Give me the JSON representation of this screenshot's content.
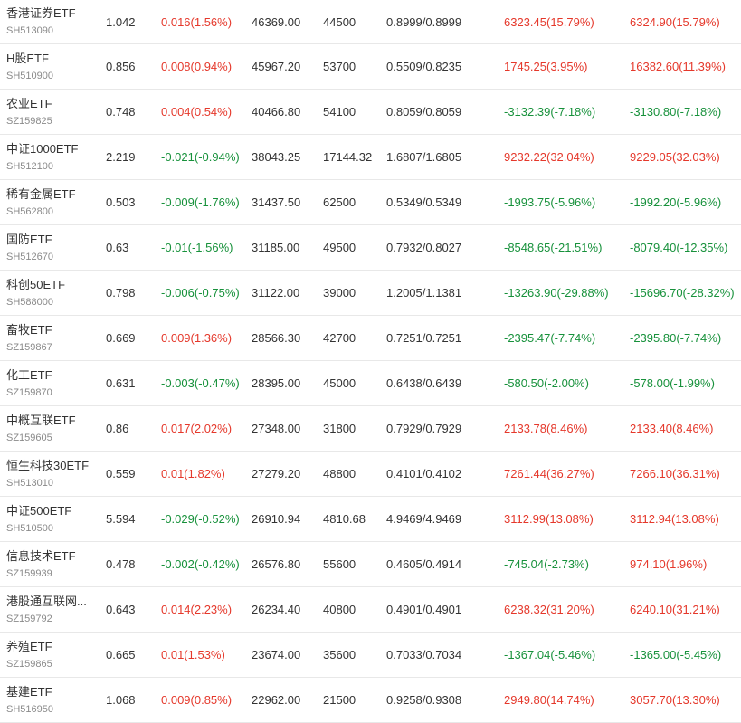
{
  "colors": {
    "up": "#e5382b",
    "down": "#17913b"
  },
  "rows": [
    {
      "name": "香港证券ETF",
      "code": "SH513090",
      "price": "1.042",
      "change": "0.016(1.56%)",
      "change_dir": "up",
      "volume": "46369.00",
      "shares": "44500",
      "nav": "0.8999/0.8999",
      "pl1": "6323.45(15.79%)",
      "pl1_dir": "up",
      "pl2": "6324.90(15.79%)",
      "pl2_dir": "up"
    },
    {
      "name": "H股ETF",
      "code": "SH510900",
      "price": "0.856",
      "change": "0.008(0.94%)",
      "change_dir": "up",
      "volume": "45967.20",
      "shares": "53700",
      "nav": "0.5509/0.8235",
      "pl1": "1745.25(3.95%)",
      "pl1_dir": "up",
      "pl2": "16382.60(11.39%)",
      "pl2_dir": "up"
    },
    {
      "name": "农业ETF",
      "code": "SZ159825",
      "price": "0.748",
      "change": "0.004(0.54%)",
      "change_dir": "up",
      "volume": "40466.80",
      "shares": "54100",
      "nav": "0.8059/0.8059",
      "pl1": "-3132.39(-7.18%)",
      "pl1_dir": "down",
      "pl2": "-3130.80(-7.18%)",
      "pl2_dir": "down"
    },
    {
      "name": "中证1000ETF",
      "code": "SH512100",
      "price": "2.219",
      "change": "-0.021(-0.94%)",
      "change_dir": "down",
      "volume": "38043.25",
      "shares": "17144.32",
      "nav": "1.6807/1.6805",
      "pl1": "9232.22(32.04%)",
      "pl1_dir": "up",
      "pl2": "9229.05(32.03%)",
      "pl2_dir": "up"
    },
    {
      "name": "稀有金属ETF",
      "code": "SH562800",
      "price": "0.503",
      "change": "-0.009(-1.76%)",
      "change_dir": "down",
      "volume": "31437.50",
      "shares": "62500",
      "nav": "0.5349/0.5349",
      "pl1": "-1993.75(-5.96%)",
      "pl1_dir": "down",
      "pl2": "-1992.20(-5.96%)",
      "pl2_dir": "down"
    },
    {
      "name": "国防ETF",
      "code": "SH512670",
      "price": "0.63",
      "change": "-0.01(-1.56%)",
      "change_dir": "down",
      "volume": "31185.00",
      "shares": "49500",
      "nav": "0.7932/0.8027",
      "pl1": "-8548.65(-21.51%)",
      "pl1_dir": "down",
      "pl2": "-8079.40(-12.35%)",
      "pl2_dir": "down"
    },
    {
      "name": "科创50ETF",
      "code": "SH588000",
      "price": "0.798",
      "change": "-0.006(-0.75%)",
      "change_dir": "down",
      "volume": "31122.00",
      "shares": "39000",
      "nav": "1.2005/1.1381",
      "pl1": "-13263.90(-29.88%)",
      "pl1_dir": "down",
      "pl2": "-15696.70(-28.32%)",
      "pl2_dir": "down"
    },
    {
      "name": "畜牧ETF",
      "code": "SZ159867",
      "price": "0.669",
      "change": "0.009(1.36%)",
      "change_dir": "up",
      "volume": "28566.30",
      "shares": "42700",
      "nav": "0.7251/0.7251",
      "pl1": "-2395.47(-7.74%)",
      "pl1_dir": "down",
      "pl2": "-2395.80(-7.74%)",
      "pl2_dir": "down"
    },
    {
      "name": "化工ETF",
      "code": "SZ159870",
      "price": "0.631",
      "change": "-0.003(-0.47%)",
      "change_dir": "down",
      "volume": "28395.00",
      "shares": "45000",
      "nav": "0.6438/0.6439",
      "pl1": "-580.50(-2.00%)",
      "pl1_dir": "down",
      "pl2": "-578.00(-1.99%)",
      "pl2_dir": "down"
    },
    {
      "name": "中概互联ETF",
      "code": "SZ159605",
      "price": "0.86",
      "change": "0.017(2.02%)",
      "change_dir": "up",
      "volume": "27348.00",
      "shares": "31800",
      "nav": "0.7929/0.7929",
      "pl1": "2133.78(8.46%)",
      "pl1_dir": "up",
      "pl2": "2133.40(8.46%)",
      "pl2_dir": "up"
    },
    {
      "name": "恒生科技30ETF",
      "code": "SH513010",
      "price": "0.559",
      "change": "0.01(1.82%)",
      "change_dir": "up",
      "volume": "27279.20",
      "shares": "48800",
      "nav": "0.4101/0.4102",
      "pl1": "7261.44(36.27%)",
      "pl1_dir": "up",
      "pl2": "7266.10(36.31%)",
      "pl2_dir": "up"
    },
    {
      "name": "中证500ETF",
      "code": "SH510500",
      "price": "5.594",
      "change": "-0.029(-0.52%)",
      "change_dir": "down",
      "volume": "26910.94",
      "shares": "4810.68",
      "nav": "4.9469/4.9469",
      "pl1": "3112.99(13.08%)",
      "pl1_dir": "up",
      "pl2": "3112.94(13.08%)",
      "pl2_dir": "up"
    },
    {
      "name": "信息技术ETF",
      "code": "SZ159939",
      "price": "0.478",
      "change": "-0.002(-0.42%)",
      "change_dir": "down",
      "volume": "26576.80",
      "shares": "55600",
      "nav": "0.4605/0.4914",
      "pl1": "-745.04(-2.73%)",
      "pl1_dir": "down",
      "pl2": "974.10(1.96%)",
      "pl2_dir": "up"
    },
    {
      "name": "港股通互联网...",
      "code": "SZ159792",
      "price": "0.643",
      "change": "0.014(2.23%)",
      "change_dir": "up",
      "volume": "26234.40",
      "shares": "40800",
      "nav": "0.4901/0.4901",
      "pl1": "6238.32(31.20%)",
      "pl1_dir": "up",
      "pl2": "6240.10(31.21%)",
      "pl2_dir": "up"
    },
    {
      "name": "养殖ETF",
      "code": "SZ159865",
      "price": "0.665",
      "change": "0.01(1.53%)",
      "change_dir": "up",
      "volume": "23674.00",
      "shares": "35600",
      "nav": "0.7033/0.7034",
      "pl1": "-1367.04(-5.46%)",
      "pl1_dir": "down",
      "pl2": "-1365.00(-5.45%)",
      "pl2_dir": "down"
    },
    {
      "name": "基建ETF",
      "code": "SH516950",
      "price": "1.068",
      "change": "0.009(0.85%)",
      "change_dir": "up",
      "volume": "22962.00",
      "shares": "21500",
      "nav": "0.9258/0.9308",
      "pl1": "2949.80(14.74%)",
      "pl1_dir": "up",
      "pl2": "3057.70(13.30%)",
      "pl2_dir": "up"
    }
  ]
}
